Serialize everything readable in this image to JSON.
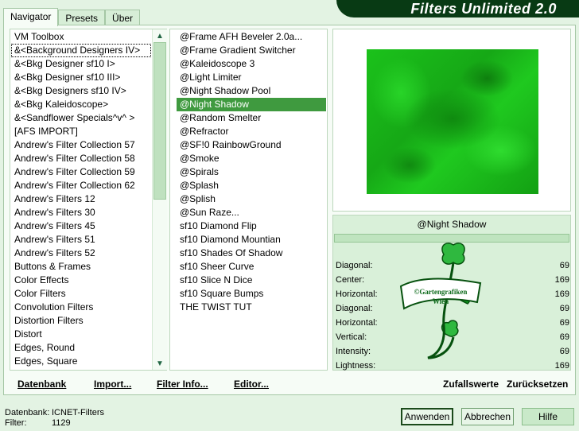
{
  "banner": {
    "title": "Filters Unlimited 2.0"
  },
  "tabs": [
    "Navigator",
    "Presets",
    "Über"
  ],
  "categories": [
    "VM Toolbox",
    "&<Background Designers IV>",
    "&<Bkg Designer sf10 I>",
    "&<Bkg Designer sf10 III>",
    "&<Bkg Designers sf10 IV>",
    "&<Bkg Kaleidoscope>",
    "&<Sandflower Specials^v^ >",
    "[AFS IMPORT]",
    "Andrew's Filter Collection 57",
    "Andrew's Filter Collection 58",
    "Andrew's Filter Collection 59",
    "Andrew's Filter Collection 62",
    "Andrew's Filters 12",
    "Andrew's Filters 30",
    "Andrew's Filters 45",
    "Andrew's Filters 51",
    "Andrew's Filters 52",
    "Buttons & Frames",
    "Color Effects",
    "Color Filters",
    "Convolution Filters",
    "Distortion Filters",
    "Distort",
    "Edges, Round",
    "Edges, Square"
  ],
  "filters": [
    "@Frame AFH Beveler 2.0a...",
    "@Frame Gradient Switcher",
    "@Kaleidoscope 3",
    "@Light Limiter",
    "@Night Shadow Pool",
    "@Night Shadow",
    "@Random Smelter",
    "@Refractor",
    "@SF!0 RainbowGround",
    "@Smoke",
    "@Spirals",
    "@Splash",
    "@Splish",
    "@Sun Raze...",
    "sf10 Diamond Flip",
    "sf10 Diamond Mountian",
    "sf10 Shades Of Shadow",
    "sf10 Sheer Curve",
    "sf10 Slice N Dice",
    "sf10 Square Bumps",
    "THE TWIST TUT"
  ],
  "selected_category": "&<Background Designers IV>",
  "selected_filter": "@Night Shadow",
  "preview": {
    "filter_name": "@Night Shadow",
    "watermark_line1": "©Gartengrafiken",
    "watermark_line2": "Wien"
  },
  "params": [
    {
      "label": "Diagonal:",
      "value": "69"
    },
    {
      "label": "Center:",
      "value": "169"
    },
    {
      "label": "Horizontal:",
      "value": "169"
    },
    {
      "label": "Diagonal:",
      "value": "69"
    },
    {
      "label": "Horizontal:",
      "value": "69"
    },
    {
      "label": "Vertical:",
      "value": "69"
    },
    {
      "label": "Intensity:",
      "value": "69"
    },
    {
      "label": "Lightness:",
      "value": "169"
    }
  ],
  "bottom_links": {
    "datenbank": "Datenbank",
    "import": "Import...",
    "filter_info": "Filter Info...",
    "editor": "Editor...",
    "zufall": "Zufallswerte",
    "reset": "Zurücksetzen"
  },
  "status": {
    "db_label": "Datenbank:",
    "db_value": "ICNET-Filters",
    "filter_label": "Filter:",
    "filter_value": "1129"
  },
  "buttons": {
    "apply": "Anwenden",
    "cancel": "Abbrechen",
    "help": "Hilfe"
  },
  "colors": {
    "accent": "#3f9a3f",
    "banner": "#083a14",
    "background": "#e3f3e3"
  }
}
